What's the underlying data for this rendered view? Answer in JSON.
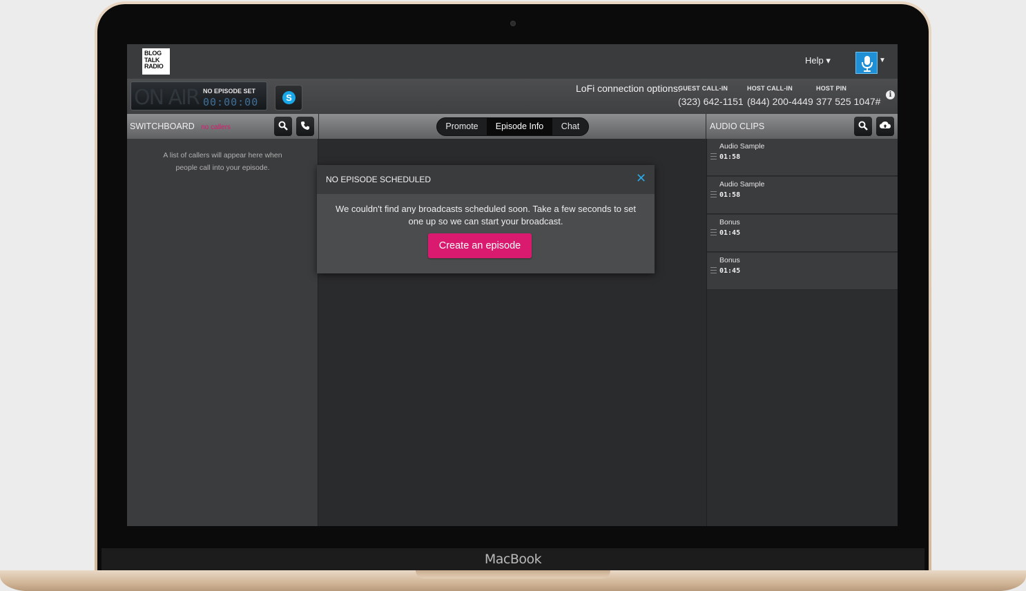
{
  "device": {
    "brand": "MacBook"
  },
  "header": {
    "logo_lines": [
      "BLOG",
      "TALK",
      "RADIO"
    ],
    "help_label": "Help ▾",
    "avatar_caret": "▼"
  },
  "statusbar": {
    "onair_label": "ON AIR",
    "episode_label": "NO EPISODE SET",
    "timer": "00:00:00",
    "skype_glyph": "S",
    "lofi_label": "LoFi connection options:",
    "connections": [
      {
        "label": "GUEST CALL-IN",
        "value": "(323) 642-1151"
      },
      {
        "label": "HOST CALL-IN",
        "value": "(844) 200-4449"
      },
      {
        "label": "HOST PIN",
        "value": "377 525 1047#"
      }
    ],
    "info_glyph": "i"
  },
  "switchboard": {
    "title": "SWITCHBOARD",
    "status": "no callers",
    "empty_text": "A list of callers will appear here when people call into your episode."
  },
  "tabs": [
    {
      "label": "Promote",
      "active": false
    },
    {
      "label": "Episode Info",
      "active": true
    },
    {
      "label": "Chat",
      "active": false
    }
  ],
  "audio_clips": {
    "title": "AUDIO CLIPS",
    "items": [
      {
        "name": "Audio Sample",
        "duration": "01:58"
      },
      {
        "name": "Audio Sample",
        "duration": "01:58"
      },
      {
        "name": "Bonus",
        "duration": "01:45"
      },
      {
        "name": "Bonus",
        "duration": "01:45"
      }
    ]
  },
  "modal": {
    "title": "NO EPISODE SCHEDULED",
    "close_glyph": "✕",
    "message": "We couldn't find any broadcasts scheduled soon. Take a few seconds to set one up so we can start your broadcast.",
    "button_label": "Create an episode"
  },
  "colors": {
    "accent_pink": "#d91a6e",
    "accent_blue": "#2aa8e6",
    "skype_blue": "#1aa7e8"
  }
}
